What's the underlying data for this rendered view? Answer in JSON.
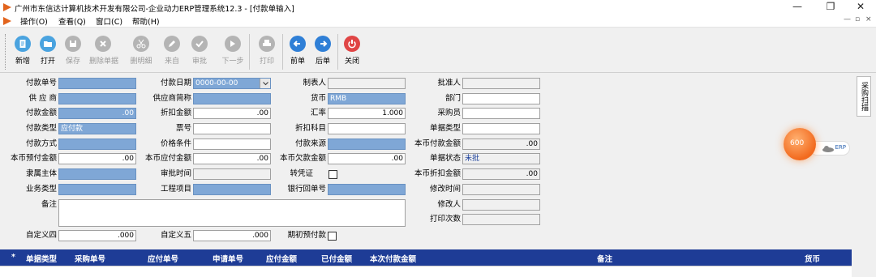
{
  "window": {
    "title": "广州市东信达计算机技术开发有限公司-企业动力ERP管理系统12.3 - [付款单输入]",
    "controls": [
      "—",
      "❐",
      "✕"
    ]
  },
  "menu": {
    "items": [
      "操作(O)",
      "查看(Q)",
      "窗口(C)",
      "帮助(H)"
    ],
    "mdi_controls": [
      "—",
      "▫",
      "×"
    ]
  },
  "toolbar": {
    "buttons": [
      {
        "label": "新增",
        "enabled": true,
        "color": "#4aa3df",
        "icon": "new-doc-icon"
      },
      {
        "label": "打开",
        "enabled": true,
        "color": "#4aa3df",
        "icon": "folder-icon"
      },
      {
        "label": "保存",
        "enabled": false,
        "icon": "save-icon"
      },
      {
        "label": "删除单据",
        "enabled": false,
        "icon": "delete-icon"
      },
      {
        "label": "删明细",
        "enabled": false,
        "icon": "scissors-icon"
      },
      {
        "label": "来自",
        "enabled": false,
        "icon": "pencil-icon"
      },
      {
        "label": "审批",
        "enabled": false,
        "icon": "approve-icon"
      },
      {
        "label": "下一步",
        "enabled": false,
        "icon": "next-step-icon"
      },
      {
        "label": "打印",
        "enabled": false,
        "icon": "print-icon"
      },
      {
        "label": "前单",
        "enabled": true,
        "color": "#2f7fd6",
        "icon": "arrow-left-icon"
      },
      {
        "label": "后单",
        "enabled": true,
        "color": "#2f7fd6",
        "icon": "arrow-right-icon"
      },
      {
        "label": "关闭",
        "enabled": true,
        "color": "#e04545",
        "icon": "power-icon"
      }
    ]
  },
  "form": {
    "payment_no": {
      "label": "付款单号",
      "value": ""
    },
    "payment_date": {
      "label": "付款日期",
      "value": "0000-00-00"
    },
    "creator": {
      "label": "制表人",
      "value": ""
    },
    "approver": {
      "label": "批准人",
      "value": ""
    },
    "supplier": {
      "label": "供 应 商",
      "value": ""
    },
    "supplier_short": {
      "label": "供应商简称",
      "value": ""
    },
    "currency": {
      "label": "货币",
      "value": "RMB"
    },
    "department": {
      "label": "部门",
      "value": ""
    },
    "payment_amount": {
      "label": "付款金额",
      "value": ".00"
    },
    "discount_amount": {
      "label": "折扣金额",
      "value": ".00"
    },
    "exchange_rate": {
      "label": "汇率",
      "value": "1.000"
    },
    "purchaser": {
      "label": "采购员",
      "value": ""
    },
    "payment_type": {
      "label": "付款类型",
      "value": "应付款"
    },
    "ticket_no": {
      "label": "票号",
      "value": ""
    },
    "discount_subject": {
      "label": "折扣科目",
      "value": ""
    },
    "doc_type": {
      "label": "单据类型",
      "value": ""
    },
    "payment_method": {
      "label": "付款方式",
      "value": ""
    },
    "price_terms": {
      "label": "价格条件",
      "value": ""
    },
    "payment_source": {
      "label": "付款来源",
      "value": ""
    },
    "local_payment_amount": {
      "label": "本币付款金额",
      "value": ".00"
    },
    "local_prepay_amount": {
      "label": "本币预付金额",
      "value": ".00"
    },
    "local_payable_amount": {
      "label": "本币应付金额",
      "value": ".00"
    },
    "local_owed_amount": {
      "label": "本币欠款金额",
      "value": ".00"
    },
    "doc_status": {
      "label": "单据状态",
      "value": "未批"
    },
    "entity": {
      "label": "隶属主体",
      "value": ""
    },
    "approval_time": {
      "label": "审批时间",
      "value": ""
    },
    "to_voucher": {
      "label": "转凭证",
      "checked": false
    },
    "local_discount_amount": {
      "label": "本币折扣金额",
      "value": ".00"
    },
    "business_type": {
      "label": "业务类型",
      "value": ""
    },
    "project": {
      "label": "工程项目",
      "value": ""
    },
    "bank_receipt_no": {
      "label": "银行回单号",
      "value": ""
    },
    "modified_time": {
      "label": "修改时间",
      "value": ""
    },
    "remarks": {
      "label": "备注",
      "value": ""
    },
    "modified_by": {
      "label": "修改人",
      "value": ""
    },
    "print_count": {
      "label": "打印次数",
      "value": ""
    },
    "custom4": {
      "label": "自定义四",
      "value": ".000"
    },
    "custom5": {
      "label": "自定义五",
      "value": ".000"
    },
    "initial_prepay": {
      "label": "期初预付款",
      "checked": false
    }
  },
  "side_tab": {
    "label": "采购扫描"
  },
  "widget": {
    "value": "600"
  },
  "grid": {
    "marker": "*",
    "columns": [
      "单据类型",
      "采购单号",
      "应付单号",
      "申请单号",
      "应付金额",
      "已付金额",
      "本次付款金额",
      "备注",
      "货币"
    ]
  },
  "colors": {
    "field_blue": "#7fa7d6",
    "grid_header": "#1e3c96",
    "form_bg": "#f0f0f0"
  }
}
